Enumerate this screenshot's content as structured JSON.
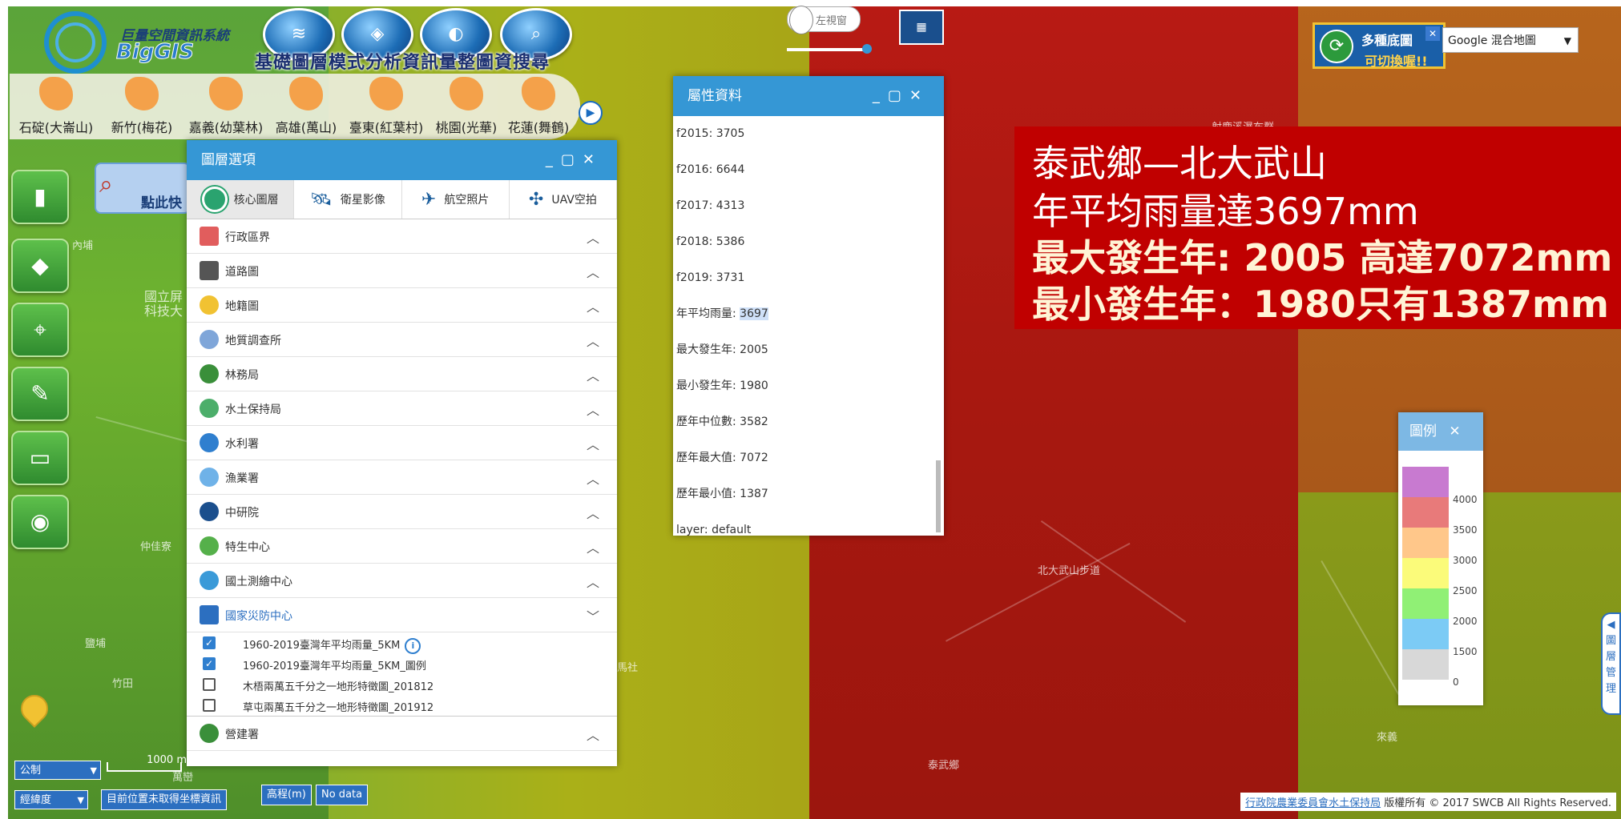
{
  "header": {
    "logo_cn": "巨量空間資訊系統",
    "logo_en": "BigGIS",
    "title": "基礎圖層模式分析資訊量整圖資搜尋"
  },
  "places": [
    "石碇(大崙山)",
    "新竹(梅花)",
    "嘉義(幼葉林)",
    "高雄(萬山)",
    "臺東(紅葉村)",
    "桃園(光華)",
    "花蓮(舞鶴)"
  ],
  "quick_button": "點此快",
  "view_toggle": "左視窗",
  "layer_panel": {
    "title": "圖層選項",
    "tabs": [
      "核心圖層",
      "衛星影像",
      "航空照片",
      "UAV空拍"
    ],
    "categories": [
      "行政區界",
      "道路圖",
      "地籍圖",
      "地質調查所",
      "林務局",
      "水土保持局",
      "水利署",
      "漁業署",
      "中研院",
      "特生中心",
      "國土測繪中心",
      "國家災防中心"
    ],
    "sublayers": [
      {
        "label": "1960-2019臺灣年平均雨量_5KM",
        "checked": "true",
        "info_icon": "info-icon"
      },
      {
        "label": "1960-2019臺灣年平均雨量_5KM_圖例",
        "checked": "true"
      },
      {
        "label": "木梧兩萬五千分之一地形特徵圖_201812",
        "checked": "false"
      },
      {
        "label": "草屯兩萬五千分之一地形特徵圖_201912",
        "checked": "false"
      }
    ],
    "last_category": "營建署"
  },
  "attr_panel": {
    "title": "屬性資料",
    "rows": [
      {
        "key": "f2015",
        "value": "3705"
      },
      {
        "key": "f2016",
        "value": "6644"
      },
      {
        "key": "f2017",
        "value": "4313"
      },
      {
        "key": "f2018",
        "value": "5386"
      },
      {
        "key": "f2019",
        "value": "3731"
      },
      {
        "key": "年平均雨量",
        "value": "3697"
      },
      {
        "key": "最大發生年",
        "value": "2005"
      },
      {
        "key": "最小發生年",
        "value": "1980"
      },
      {
        "key": "歷年中位數",
        "value": "3582"
      },
      {
        "key": "歷年最大值",
        "value": "7072"
      },
      {
        "key": "歷年最小值",
        "value": "1387"
      },
      {
        "key": "layer",
        "value": "default"
      }
    ]
  },
  "basemap": {
    "banner_line1": "多種底圖",
    "banner_line2": "可切換喔!!",
    "select_value": "Google 混合地圖"
  },
  "info_box": {
    "line1": "泰武鄉—北大武山",
    "line2": "年平均雨量達3697mm",
    "line3": "最大發生年: 2005 高達7072mm",
    "line4": "最小發生年：1980只有1387mm"
  },
  "legend": {
    "title": "圖例",
    "items": [
      {
        "color": "#c87ad0",
        "label": ""
      },
      {
        "color": "#e87a7a",
        "label": "4000"
      },
      {
        "color": "#ffc78a",
        "label": "3500"
      },
      {
        "color": "#fbfb7a",
        "label": "3000"
      },
      {
        "color": "#90f075",
        "label": "2500"
      },
      {
        "color": "#7ccbf5",
        "label": "2000"
      },
      {
        "color": "#d8d8d8",
        "label": "1500"
      }
    ],
    "bottom_label": "0"
  },
  "side_tab": [
    "圖",
    "層",
    "管",
    "理"
  ],
  "bottom": {
    "unit_select": "公制",
    "coord_select": "經緯度",
    "scale": "1000 m",
    "coord_button": "目前位置未取得坐標資訊",
    "elevation_label": "高程(m)",
    "elevation_value": "No data"
  },
  "map_labels": {
    "mountain_trail": "北大武山步道",
    "taiwu": "泰武鄉",
    "top_waterfall": "射鹿溪瀑布群",
    "school": "國立屏",
    "school2": "科技大",
    "neipu": "內埔",
    "wanluan": "萬巒",
    "zhongxing": "仲佳寮",
    "yanpu": "鹽埔",
    "shrine": "馬社",
    "zhuqi": "竹田",
    "laiyi": "來義"
  },
  "footer": {
    "agency": "行政院農業委員會水土保持局",
    "copyright": "版權所有 © 2017 SWCB All Rights Reserved."
  }
}
